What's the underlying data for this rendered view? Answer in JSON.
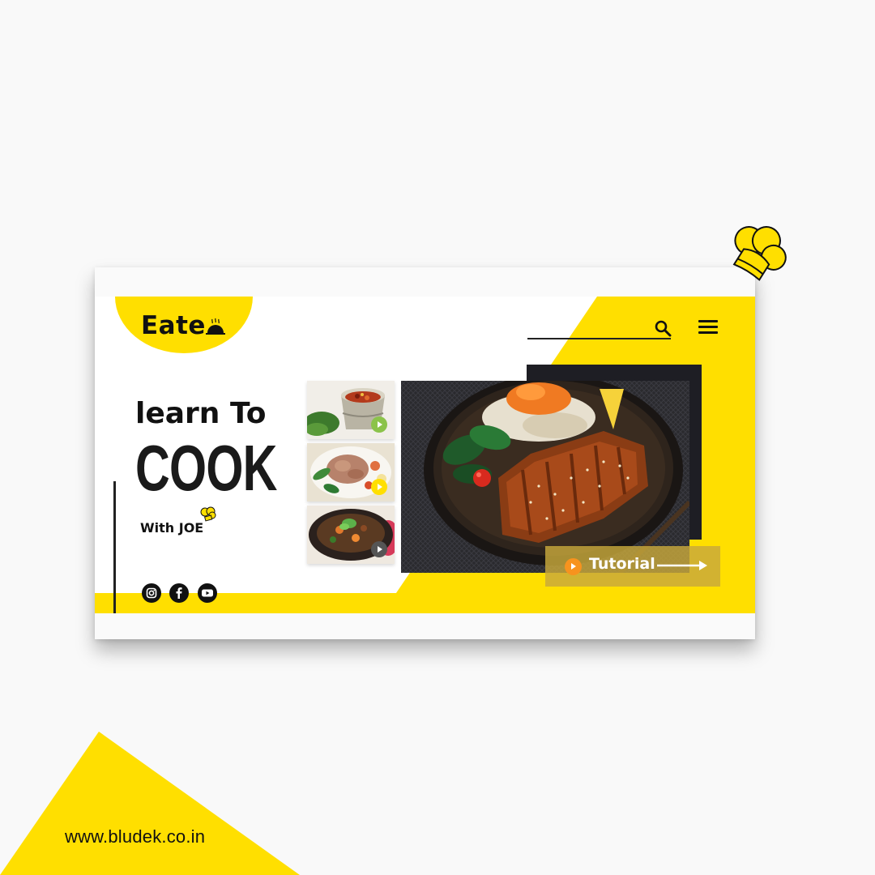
{
  "brand": {
    "logo_text": "Eate"
  },
  "hero": {
    "line1": "learn To",
    "line2": "COOK",
    "line3": "With JOE"
  },
  "tutorial": {
    "label": "Tutorial"
  },
  "social": [
    "instagram-icon",
    "facebook-icon",
    "youtube-icon"
  ],
  "footer": {
    "url": "www.bludek.co.in"
  },
  "colors": {
    "accent": "#ffdf00",
    "dark": "#1e1e24",
    "orange": "#f7931e",
    "thumb_play_green": "#8bc34a",
    "thumb_play_yellow": "#ffdf00",
    "thumb_play_gray": "#555555"
  }
}
